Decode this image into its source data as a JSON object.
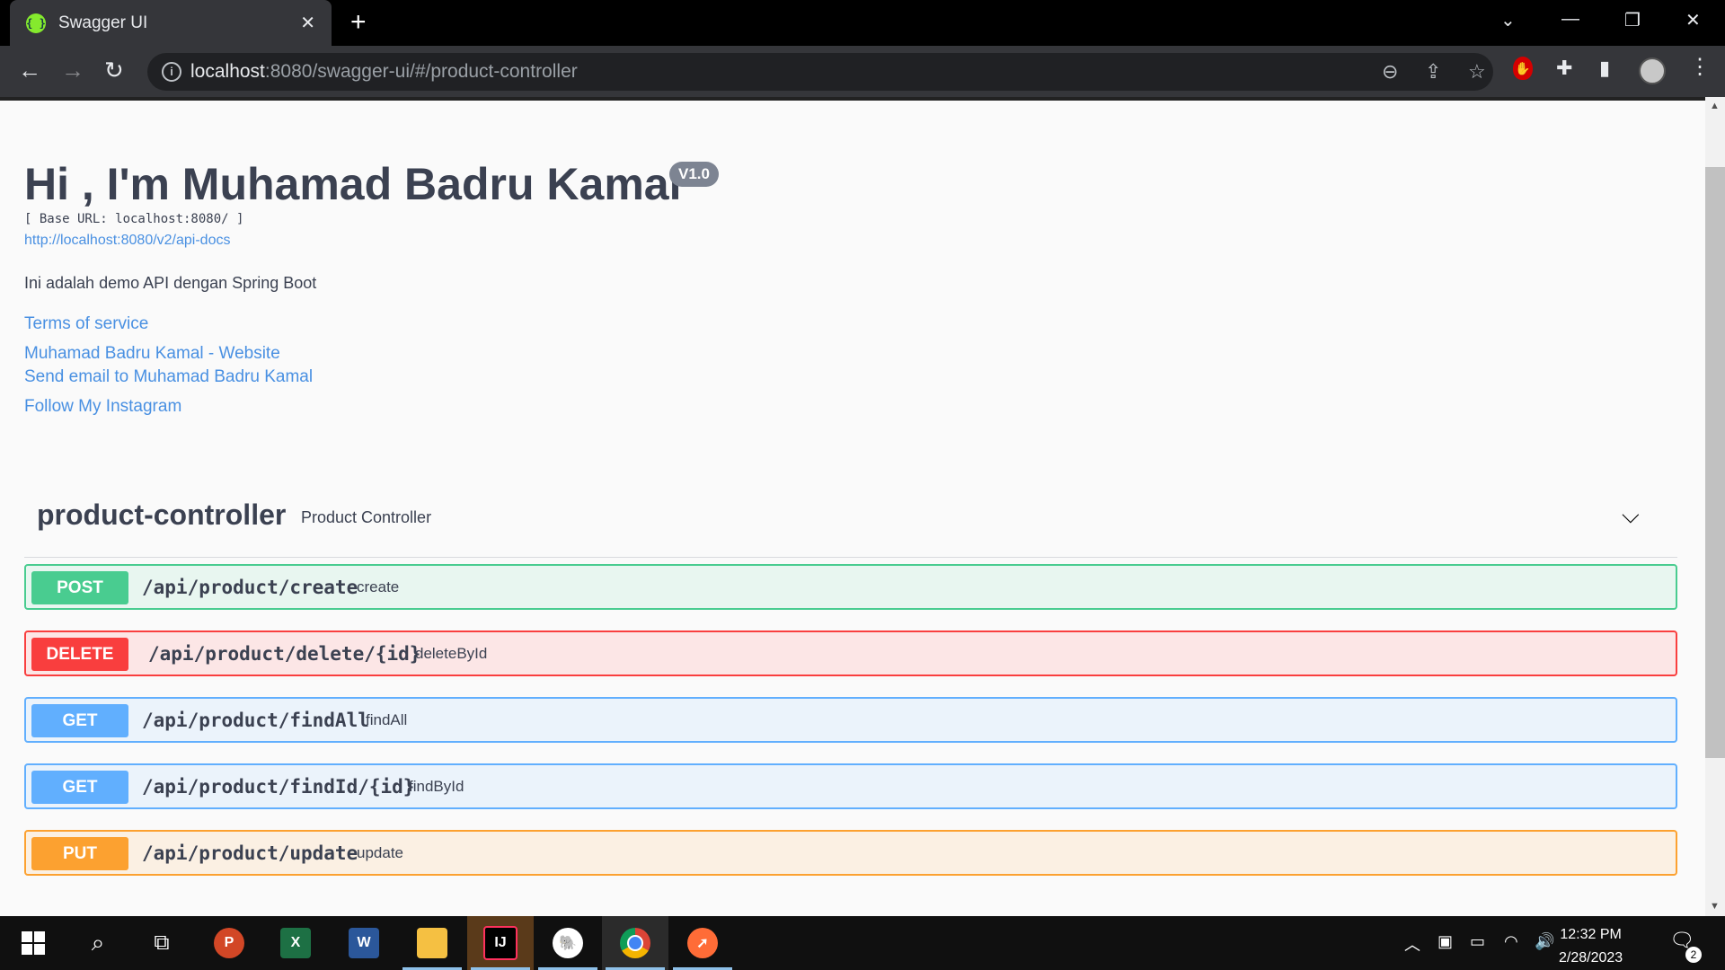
{
  "browser": {
    "tab_title": "Swagger UI",
    "favicon_text": "{ }",
    "url_host": "localhost",
    "url_rest": ":8080/swagger-ui/#/product-controller"
  },
  "swagger": {
    "title": "Hi , I'm Muhamad Badru Kamal",
    "version": "V1.0",
    "base_url": "[ Base URL: localhost:8080/ ]",
    "api_docs_link": "http://localhost:8080/v2/api-docs",
    "description": "Ini adalah demo API dengan Spring Boot",
    "links": {
      "terms": "Terms of service",
      "website": "Muhamad Badru Kamal - Website",
      "email": "Send email to Muhamad Badru Kamal",
      "instagram": "Follow My Instagram"
    },
    "controller": {
      "name": "product-controller",
      "description": "Product Controller",
      "operations": [
        {
          "method": "POST",
          "path": "/api/product/create",
          "summary": "create"
        },
        {
          "method": "DELETE",
          "path": "/api/product/delete/{id}",
          "summary": "deleteById"
        },
        {
          "method": "GET",
          "path": "/api/product/findAll",
          "summary": "findAll"
        },
        {
          "method": "GET",
          "path": "/api/product/findId/{id}",
          "summary": "findById"
        },
        {
          "method": "PUT",
          "path": "/api/product/update",
          "summary": "update"
        }
      ]
    }
  },
  "colors": {
    "post": "#49cc90",
    "delete": "#f93e3e",
    "get": "#61affe",
    "put": "#fca130",
    "link": "#4990e2",
    "text": "#3b4151"
  },
  "taskbar": {
    "time": "12:32 PM",
    "date": "2/28/2023",
    "notification_count": "2",
    "apps": [
      "windows-start",
      "search",
      "task-view",
      "powerpoint",
      "excel",
      "word",
      "file-explorer",
      "intellij-idea",
      "postgres",
      "chrome",
      "postman"
    ]
  }
}
